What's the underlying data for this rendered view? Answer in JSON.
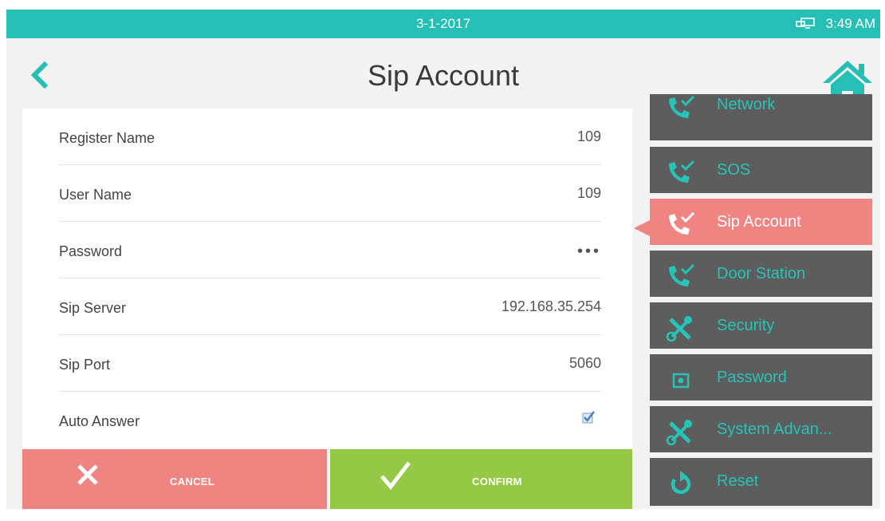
{
  "status_bar": {
    "date": "3-1-2017",
    "time": "3:49 AM",
    "network_icon": "network-icon"
  },
  "header": {
    "title": "Sip Account",
    "back_icon": "chevron-left-icon",
    "home_icon": "home-icon"
  },
  "settings": [
    {
      "label": "Register Name",
      "value": "109"
    },
    {
      "label": "User Name",
      "value": "109"
    },
    {
      "label": "Password",
      "value": "•••"
    },
    {
      "label": "Sip Server",
      "value": "192.168.35.254"
    },
    {
      "label": "Sip Port",
      "value": "5060"
    },
    {
      "label": "Auto Answer",
      "checked": true
    }
  ],
  "buttons": {
    "cancel": "CANCEL",
    "confirm": "CONFIRM"
  },
  "menu": [
    {
      "label": "Network",
      "icon": "phone-check-icon"
    },
    {
      "label": "SOS",
      "icon": "phone-check-icon"
    },
    {
      "label": "Sip Account",
      "icon": "phone-check-icon",
      "active": true
    },
    {
      "label": "Door Station",
      "icon": "phone-check-icon"
    },
    {
      "label": "Security",
      "icon": "tools-icon"
    },
    {
      "label": "Password",
      "icon": "password-box-icon"
    },
    {
      "label": "System Advan...",
      "icon": "tools-icon"
    },
    {
      "label": "Reset",
      "icon": "reset-icon"
    }
  ],
  "colors": {
    "accent": "#26bfb5",
    "active": "#ef8483",
    "cancel": "#ef8483",
    "confirm": "#95c844",
    "menu_bg": "#5d5d5d",
    "menu_text": "#26c3b8"
  }
}
